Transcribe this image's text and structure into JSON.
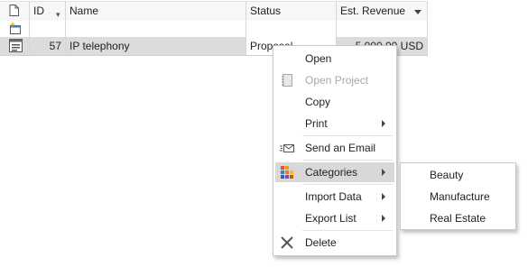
{
  "grid": {
    "columns": {
      "id": "ID",
      "name": "Name",
      "status": "Status",
      "revenue": "Est. Revenue"
    },
    "rows": [
      {
        "id": "57",
        "name": "IP telephony",
        "status": "Proposal",
        "revenue": "5,000.00 USD"
      }
    ]
  },
  "context_menu": {
    "items": [
      {
        "label": "Open",
        "icon": "",
        "disabled": false
      },
      {
        "label": "Open Project",
        "icon": "notebook-icon",
        "disabled": true
      },
      {
        "label": "Copy",
        "icon": "",
        "disabled": false
      },
      {
        "label": "Print",
        "icon": "",
        "disabled": false,
        "submenu": true
      },
      {
        "label": "Send an Email",
        "icon": "email-icon",
        "disabled": false
      },
      {
        "label": "Categories",
        "icon": "categories-icon",
        "disabled": false,
        "submenu": true,
        "highlighted": true
      },
      {
        "label": "Import Data",
        "icon": "",
        "disabled": false,
        "submenu": true
      },
      {
        "label": "Export List",
        "icon": "",
        "disabled": false,
        "submenu": true
      },
      {
        "label": "Delete",
        "icon": "delete-icon",
        "disabled": false
      }
    ]
  },
  "categories_submenu": {
    "items": [
      "Beauty",
      "Manufacture",
      "Real Estate"
    ]
  },
  "colors": {
    "highlight": "#d8d8d8",
    "selected_row": "#dcdcdc"
  }
}
